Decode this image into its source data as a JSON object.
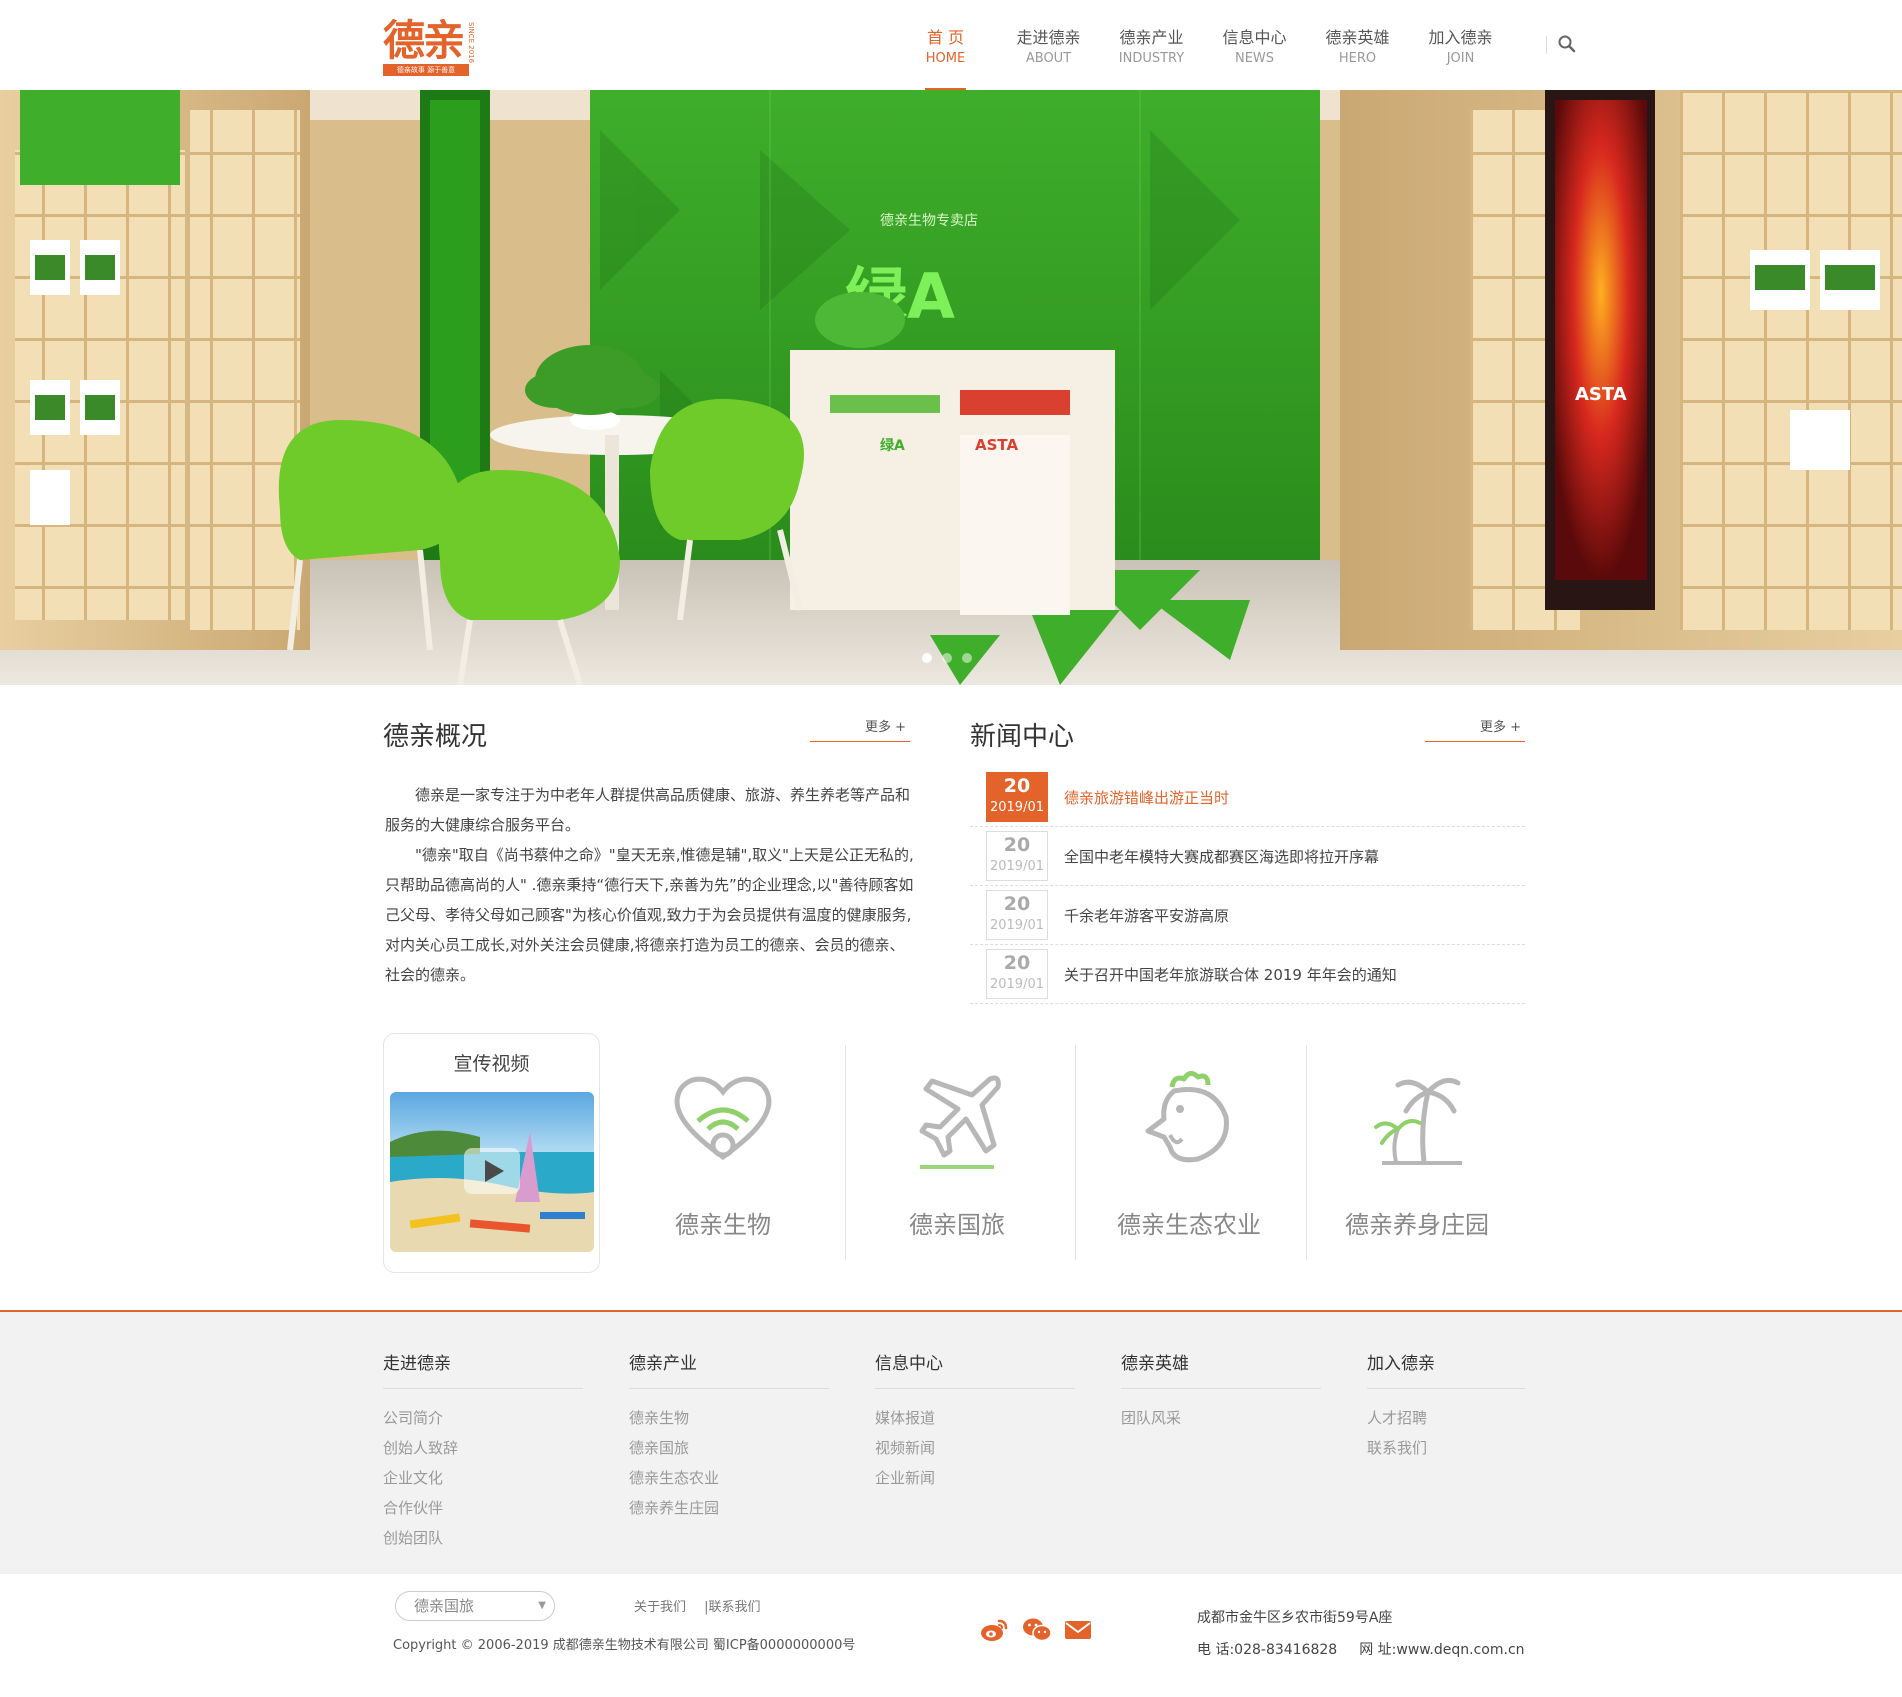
{
  "brand": {
    "name": "德亲",
    "since": "SINCE 2016",
    "slogan": "德亲故事 源于善意",
    "accent": "#e4632a"
  },
  "nav": [
    {
      "zh": "首 页",
      "en": "HOME"
    },
    {
      "zh": "走进德亲",
      "en": "ABOUT"
    },
    {
      "zh": "德亲产业",
      "en": "INDUSTRY"
    },
    {
      "zh": "信息中心",
      "en": "NEWS"
    },
    {
      "zh": "德亲英雄",
      "en": "HERO"
    },
    {
      "zh": "加入德亲",
      "en": "JOIN"
    }
  ],
  "banner": {
    "slide_count": 3,
    "active": 1
  },
  "about": {
    "title": "德亲概况",
    "more": "更多 +",
    "p1": "德亲是一家专注于为中老年人群提供高品质健康、旅游、养生养老等产品和服务的大健康综合服务平台。",
    "p2": "\"德亲\"取自《尚书蔡仲之命》\"皇天无亲,惟德是辅\",取义\"上天是公正无私的,只帮助品德高尚的人\" .德亲秉持“德行天下,亲善为先”的企业理念,以\"善待顾客如己父母、孝待父母如己顾客\"为核心价值观,致力于为会员提供有温度的健康服务,对内关心员工成长,对外关注会员健康,将德亲打造为员工的德亲、会员的德亲、社会的德亲。"
  },
  "news": {
    "title": "新闻中心",
    "more": "更多 +",
    "items": [
      {
        "day": "20",
        "ym": "2019/01",
        "title": "德亲旅游错峰出游正当时"
      },
      {
        "day": "20",
        "ym": "2019/01",
        "title": "全国中老年模特大赛成都赛区海选即将拉开序幕"
      },
      {
        "day": "20",
        "ym": "2019/01",
        "title": "千余老年游客平安游高原"
      },
      {
        "day": "20",
        "ym": "2019/01",
        "title": "关于召开中国老年旅游联合体 2019 年年会的通知"
      }
    ]
  },
  "video": {
    "title": "宣传视频"
  },
  "industries": [
    {
      "label": "德亲生物",
      "icon": "heart-icon"
    },
    {
      "label": "德亲国旅",
      "icon": "airplane-icon"
    },
    {
      "label": "德亲生态农业",
      "icon": "rooster-icon"
    },
    {
      "label": "德亲养身庄园",
      "icon": "palm-tree-icon"
    }
  ],
  "footer": {
    "cols": [
      {
        "title": "走进德亲",
        "links": [
          "公司简介",
          "创始人致辞",
          "企业文化",
          "合作伙伴",
          "创始团队"
        ]
      },
      {
        "title": "德亲产业",
        "links": [
          "德亲生物",
          "德亲国旅",
          "德亲生态农业",
          "德亲养生庄园"
        ]
      },
      {
        "title": "信息中心",
        "links": [
          "媒体报道",
          "视频新闻",
          "企业新闻"
        ]
      },
      {
        "title": "德亲英雄",
        "links": [
          "团队风采"
        ]
      },
      {
        "title": "加入德亲",
        "links": [
          "人才招聘",
          "联系我们"
        ]
      }
    ]
  },
  "bottom": {
    "select_value": "德亲国旅",
    "link1": "关于我们",
    "link2": "|联系我们",
    "copyright": "Copyright © 2006-2019 成都德亲生物技术有限公司  蜀ICP备0000000000号",
    "address": "成都市金牛区乡农市街59号A座",
    "phone": "电  话:028-83416828",
    "website": "网  址:www.deqn.com.cn"
  }
}
